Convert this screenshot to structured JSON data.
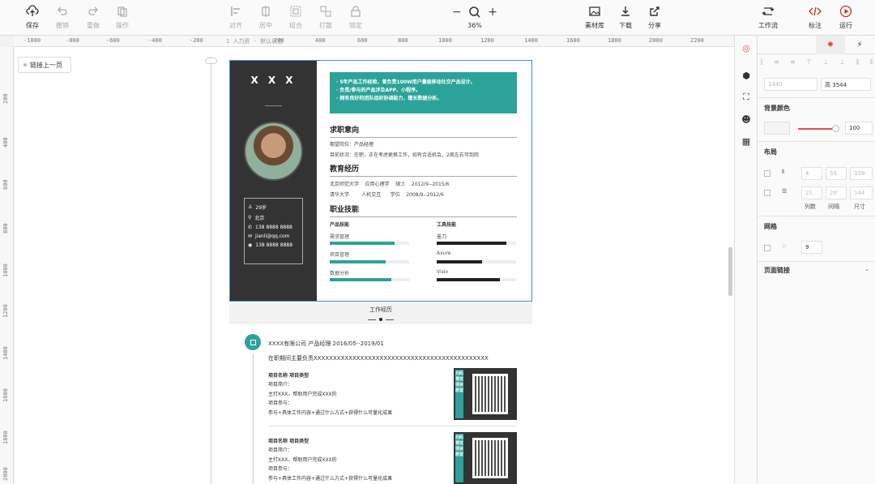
{
  "toolbar": {
    "save": "保存",
    "undo": "撤销",
    "redo": "重做",
    "operate": "操作",
    "align": "对齐",
    "distribute": "居中",
    "group": "组合",
    "ungroup": "打散",
    "lock": "锁定",
    "zoom": "36%",
    "assets": "素材库",
    "download": "下载",
    "share": "分享",
    "workflow": "工作流",
    "annotate": "标注",
    "run": "运行"
  },
  "ruler": {
    "h_ticks": [
      "-1000",
      "-800",
      "-600",
      "-400",
      "-200",
      "200",
      "400",
      "600",
      "800",
      "1000",
      "1200",
      "1400",
      "1600",
      "1800",
      "2000",
      "2200"
    ],
    "v_ticks": [
      "200",
      "400",
      "600",
      "800",
      "1000",
      "1200",
      "1400",
      "1600",
      "1800",
      "2000"
    ],
    "page_label": "1 人力资 · 默认状态"
  },
  "canvas": {
    "back_button": "链接上一页"
  },
  "resume": {
    "name": "X X X",
    "info": {
      "age": "29岁",
      "city": "北京",
      "phone": "138 8888 8888",
      "email": "jianli@qq.com",
      "wechat": "138 8888 8888"
    },
    "highlights": [
      "· 5年产品工作经验，曾负责100W用户量级移动社交产品设计。",
      "· 负责/参与的产品涉及APP、小程序。",
      "· 拥有良好的团队组织协调能力，擅长数据分析。"
    ],
    "intent_title": "求职意向",
    "intent_lines": [
      "期望岗位：产品经理",
      "目前状况：在职，正在考虑更换工作，如有合适机会，2周左右可到岗"
    ],
    "edu_title": "教育经历",
    "edu_lines": [
      "北京师范大学    应用心理学    硕士    2012/9--2015/6",
      "清华大学        人机交互      学位    2008/9--2012/6"
    ],
    "skill_title": "职业技能",
    "product_skills_title": "产品技能",
    "tool_skills_title": "工具技能",
    "product_skills": [
      {
        "name": "需求管理",
        "level": 0.82
      },
      {
        "name": "项目管理",
        "level": 0.7
      },
      {
        "name": "数据分析",
        "level": 0.78
      }
    ],
    "tool_skills": [
      {
        "name": "墨刀",
        "level": 0.88
      },
      {
        "name": "Axure",
        "level": 0.57
      },
      {
        "name": "Visio",
        "level": 0.8
      }
    ],
    "accent_color": "#2ca39a",
    "skill_bar_dark": "#222222"
  },
  "work_section": {
    "title": "工作经历",
    "company_line": "XXXX有限公司  产品经理  2016/05--2019/01",
    "duty_line": "在职期间主要负责XXXXXXXXXXXXXXXXXXXXXXXXXXXXXXXXXXXXXXXXXXXXX",
    "projects": [
      {
        "name": "项目名称   项目类型",
        "intro": "项目简介：",
        "line1": "主打XXX，帮助用户完成XXX的",
        "role": "项目参与：",
        "line2": "参与+具体工作内容+通过什么方式+获得什么可量化成果",
        "qr_label": "扫码预览项目原型"
      },
      {
        "name": "项目名称   项目类型",
        "intro": "项目简介：",
        "line1": "主打XXX，帮助用户完成XXX的",
        "role": "项目参与：",
        "line2": "参与+具体工作内容+通过什么方式+获得什么可量化成果",
        "qr_label": "扫码预览项目原型"
      }
    ]
  },
  "panel": {
    "width_value": "1440",
    "height_label": "高",
    "height_value": "3544",
    "bg_color_title": "背景颜色",
    "opacity_value": "100",
    "layout_title": "布局",
    "row1": [
      "4",
      "55",
      "309"
    ],
    "row2": [
      "21",
      "20",
      "144"
    ],
    "col_labels": [
      "列数",
      "间隔",
      "尺寸"
    ],
    "grid_title": "网格",
    "grid_value": "9",
    "page_link_title": "页面链接"
  }
}
